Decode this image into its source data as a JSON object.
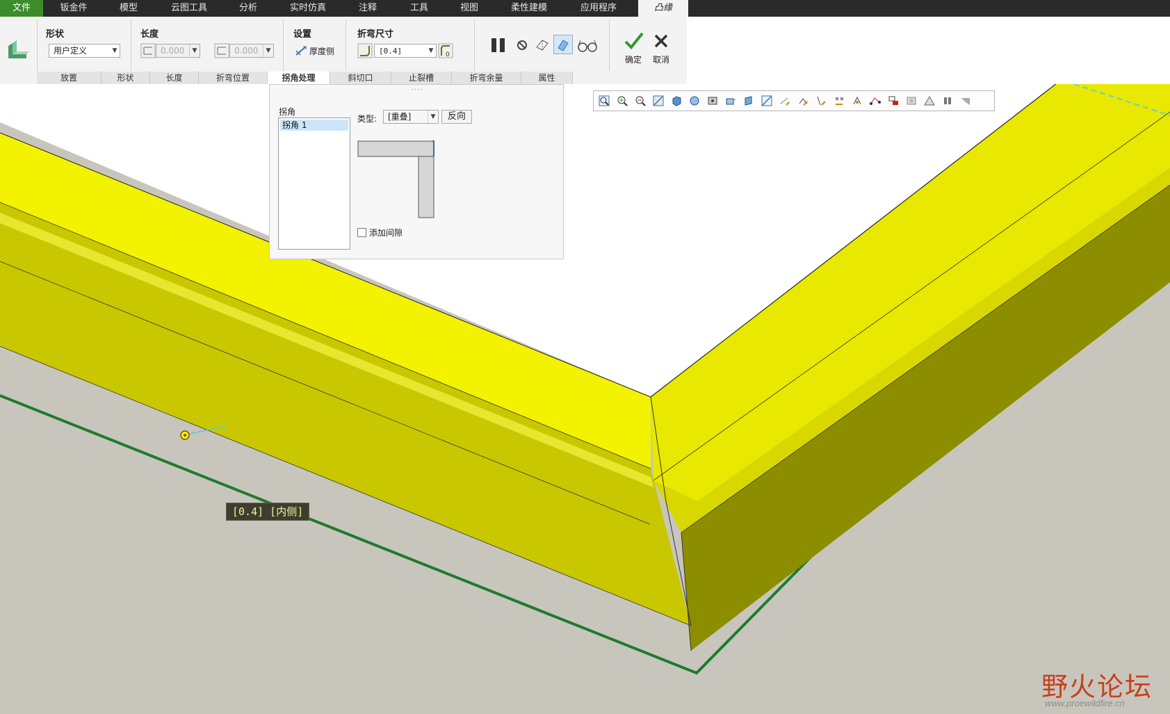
{
  "tabs": [
    {
      "label": "文件"
    },
    {
      "label": "钣金件"
    },
    {
      "label": "模型"
    },
    {
      "label": "云图工具"
    },
    {
      "label": "分析"
    },
    {
      "label": "实时仿真"
    },
    {
      "label": "注释"
    },
    {
      "label": "工具"
    },
    {
      "label": "视图"
    },
    {
      "label": "柔性建模"
    },
    {
      "label": "应用程序"
    },
    {
      "label": "凸缘"
    }
  ],
  "ribbon": {
    "shape": {
      "title": "形状",
      "value": "用户定义"
    },
    "length": {
      "title": "长度",
      "value1": "0.000",
      "value2": "0.000"
    },
    "settings": {
      "title": "设置",
      "thickness_side": "厚度侧"
    },
    "bend_size": {
      "title": "折弯尺寸",
      "value": "[0.4]"
    },
    "ok_label": "确定",
    "cancel_label": "取消",
    "subtabs": [
      {
        "label": "放置"
      },
      {
        "label": "形状"
      },
      {
        "label": "长度"
      },
      {
        "label": "折弯位置"
      },
      {
        "label": "拐角处理"
      },
      {
        "label": "斜切口"
      },
      {
        "label": "止裂槽"
      },
      {
        "label": "折弯余量"
      },
      {
        "label": "属性"
      }
    ],
    "active_subtab": "拐角处理"
  },
  "corner_panel": {
    "list_title": "拐角",
    "items": [
      {
        "label": "拐角 1"
      }
    ],
    "type_label": "类型:",
    "type_value": "[重叠]",
    "reverse_label": "反向",
    "add_gap_label": "添加间隙",
    "add_gap_checked": false
  },
  "annotation": {
    "label": "[0.4] [内侧]"
  },
  "view_toolbar": {
    "icons": [
      "refit-icon",
      "zoom-in-icon",
      "zoom-out-icon",
      "repaint-icon",
      "display-style-icon",
      "saved-views-icon",
      "view-manager-icon",
      "perspective-icon",
      "section-icon",
      "datum-display-icon",
      "plane-display-icon",
      "axis-display-icon",
      "point-display-icon",
      "csys-display-icon",
      "spin-center-icon",
      "annotation-display-icon",
      "appearance-icon",
      "simulation-icon",
      "triangle-icon",
      "pause-icon",
      "flag-icon"
    ]
  },
  "colors": {
    "flange_yellow": "#f3f200",
    "flange_top": "#e6e400",
    "flange_side": "#8a8c00",
    "edge_green": "#1f7a2e",
    "floor": "#c8c6bc",
    "tab_active_bg": "#3c8c2c"
  },
  "watermark": {
    "title": "野火论坛",
    "url": "www.proewildfire.cn"
  }
}
